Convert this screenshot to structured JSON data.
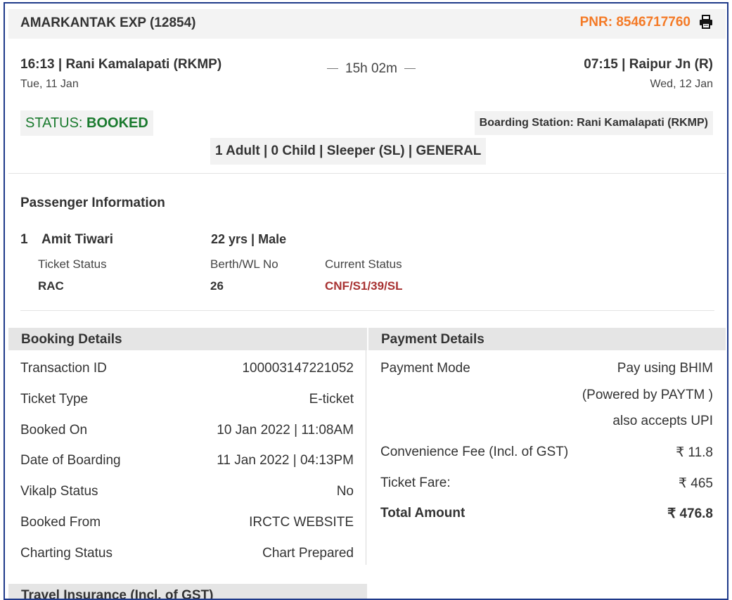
{
  "header": {
    "train": "AMARKANTAK EXP (12854)",
    "pnr": "PNR: 8546717760",
    "print_icon": "printer-icon"
  },
  "journey": {
    "departure": "16:13 | Rani Kamalapati (RKMP)",
    "departure_date": "Tue, 11 Jan",
    "duration": "15h 02m",
    "arrival": "07:15 | Raipur Jn (R)",
    "arrival_date": "Wed, 12 Jan"
  },
  "status": {
    "label": "STATUS: ",
    "value": "BOOKED",
    "color": "#1a7a2e"
  },
  "boarding_station": "Boarding Station: Rani Kamalapati (RKMP)",
  "passenger_summary": "1 Adult | 0 Child | Sleeper (SL) | GENERAL",
  "passenger_info": {
    "title": "Passenger Information",
    "passengers": [
      {
        "number": "1",
        "name": "Amit Tiwari",
        "age_gender": "22 yrs | Male",
        "ticket_status_label": "Ticket Status",
        "ticket_status": "RAC",
        "berth_label": "Berth/WL No",
        "berth": "26",
        "current_status_label": "Current Status",
        "current_status": "CNF/S1/39/SL"
      }
    ]
  },
  "booking_details": {
    "title": "Booking Details",
    "rows": [
      {
        "label": "Transaction ID",
        "value": "100003147221052"
      },
      {
        "label": "Ticket Type",
        "value": "E-ticket"
      },
      {
        "label": "Booked On",
        "value": "10 Jan 2022 | 11:08AM"
      },
      {
        "label": "Date of Boarding",
        "value": "11 Jan 2022 | 04:13PM"
      },
      {
        "label": "Vikalp Status",
        "value": "No"
      },
      {
        "label": "Booked From",
        "value": "IRCTC WEBSITE"
      },
      {
        "label": "Charting Status",
        "value": "Chart Prepared"
      }
    ]
  },
  "payment_details": {
    "title": "Payment Details",
    "mode_label": "Payment Mode",
    "mode_lines": [
      "Pay using BHIM",
      "(Powered by PAYTM )",
      "also accepts UPI"
    ],
    "fee_label": "Convenience Fee (Incl. of GST)",
    "fee_value": "₹ 11.8",
    "fare_label": "Ticket Fare:",
    "fare_value": "₹ 465",
    "total_label": "Total Amount",
    "total_value": "₹ 476.8"
  },
  "insurance": {
    "title": "Travel Insurance (Incl. of GST)"
  },
  "colors": {
    "accent": "#f47a26",
    "booked": "#1a7a2e",
    "current_status": "#a83232",
    "border": "#1f3a8a"
  }
}
